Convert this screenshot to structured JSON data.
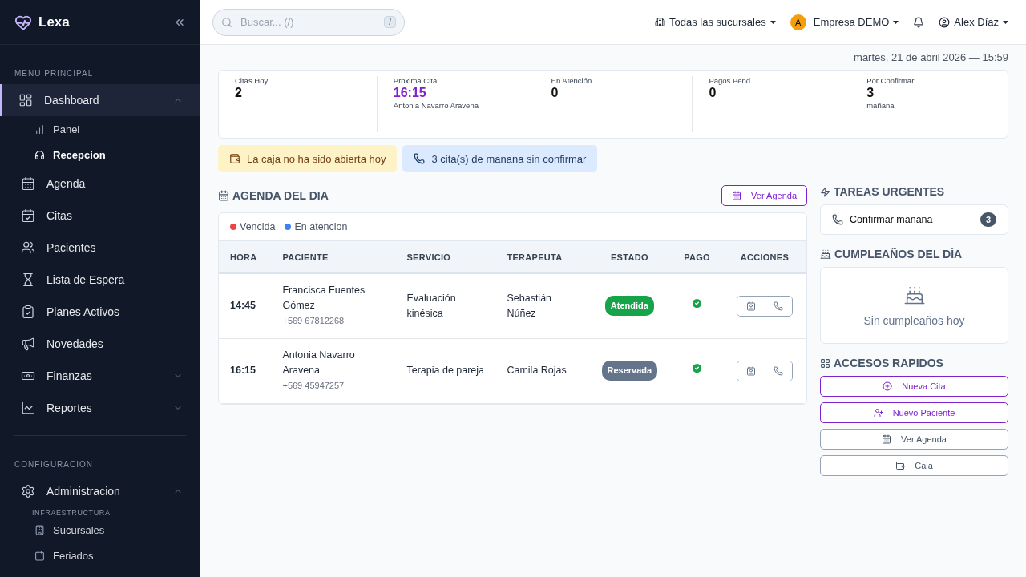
{
  "brand": {
    "name": "Lexa"
  },
  "sidebar": {
    "sections": [
      {
        "title": "MENU PRINCIPAL",
        "items": [
          {
            "label": "Dashboard",
            "selected": true,
            "expanded": true,
            "children": [
              {
                "label": "Panel",
                "selected": false
              },
              {
                "label": "Recepcion",
                "selected": true
              }
            ]
          },
          {
            "label": "Agenda",
            "selected": false
          },
          {
            "label": "Citas",
            "selected": false
          },
          {
            "label": "Pacientes",
            "selected": false
          },
          {
            "label": "Lista de Espera",
            "selected": false
          },
          {
            "label": "Planes Activos",
            "selected": false
          },
          {
            "label": "Novedades",
            "selected": false
          },
          {
            "label": "Finanzas",
            "selected": false,
            "expanded": false
          },
          {
            "label": "Reportes",
            "selected": false,
            "expanded": false
          }
        ]
      },
      {
        "title": "CONFIGURACION",
        "items": [
          {
            "label": "Administracion",
            "selected": false,
            "expanded": true,
            "group": "INFRAESTRUCTURA",
            "children": [
              {
                "label": "Sucursales",
                "selected": false
              },
              {
                "label": "Feriados",
                "selected": false
              }
            ]
          }
        ]
      }
    ]
  },
  "topbar": {
    "search": {
      "placeholder": "Buscar... (/)",
      "shortcut": "/"
    },
    "branch": "Todas las sucursales",
    "company": {
      "avatar": "A",
      "name": "Empresa DEMO"
    },
    "user": "Alex Díaz"
  },
  "date": "martes, 21 de abril 2026 — 15:59",
  "stats": [
    {
      "label": "Citas Hoy",
      "value": "2",
      "highlighted": false
    },
    {
      "label": "Proxima Cita",
      "value": "16:15",
      "sub": "Antonia Navarro Aravena",
      "highlighted": true
    },
    {
      "label": "En Atención",
      "value": "0",
      "highlighted": false
    },
    {
      "label": "Pagos Pend.",
      "value": "0",
      "highlighted": false
    },
    {
      "label": "Por Confirmar",
      "value": "3",
      "sub": "mañana",
      "highlighted": false
    }
  ],
  "alerts": [
    {
      "kind": "warning",
      "text": "La caja no ha sido abierta hoy"
    },
    {
      "kind": "info",
      "text": "3 cita(s) de manana sin confirmar"
    }
  ],
  "agenda": {
    "title": "AGENDA DEL DIA",
    "button": "Ver Agenda",
    "legend": [
      {
        "label": "Vencida",
        "color": "#ef4444"
      },
      {
        "label": "En atencion",
        "color": "#3b82f6"
      }
    ],
    "columns": [
      "HORA",
      "PACIENTE",
      "SERVICIO",
      "TERAPEUTA",
      "ESTADO",
      "PAGO",
      "ACCIONES"
    ],
    "rows": [
      {
        "time": "14:45",
        "patient": "Francisca Fuentes Gómez",
        "phone": "+569 67812268",
        "service": "Evaluación kinésica",
        "therapist": "Sebastián Núñez",
        "status": {
          "label": "Atendida",
          "kind": "done"
        },
        "paid": true
      },
      {
        "time": "16:15",
        "patient": "Antonia Navarro Aravena",
        "phone": "+569 45947257",
        "service": "Terapia de pareja",
        "therapist": "Camila Rojas",
        "status": {
          "label": "Reservada",
          "kind": "booked"
        },
        "paid": true
      }
    ]
  },
  "tasks": {
    "title": "TAREAS URGENTES",
    "items": [
      {
        "label": "Confirmar manana",
        "count": "3"
      }
    ]
  },
  "birthdays": {
    "title": "CUMPLEAÑOS DEL DÍA",
    "empty": "Sin cumpleaños hoy"
  },
  "shortcuts": {
    "title": "ACCESOS RAPIDOS",
    "buttons": [
      {
        "label": "Nueva Cita",
        "kind": "primary"
      },
      {
        "label": "Nuevo Paciente",
        "kind": "primary"
      },
      {
        "label": "Ver Agenda",
        "kind": "secondary"
      },
      {
        "label": "Caja",
        "kind": "secondary"
      }
    ]
  }
}
